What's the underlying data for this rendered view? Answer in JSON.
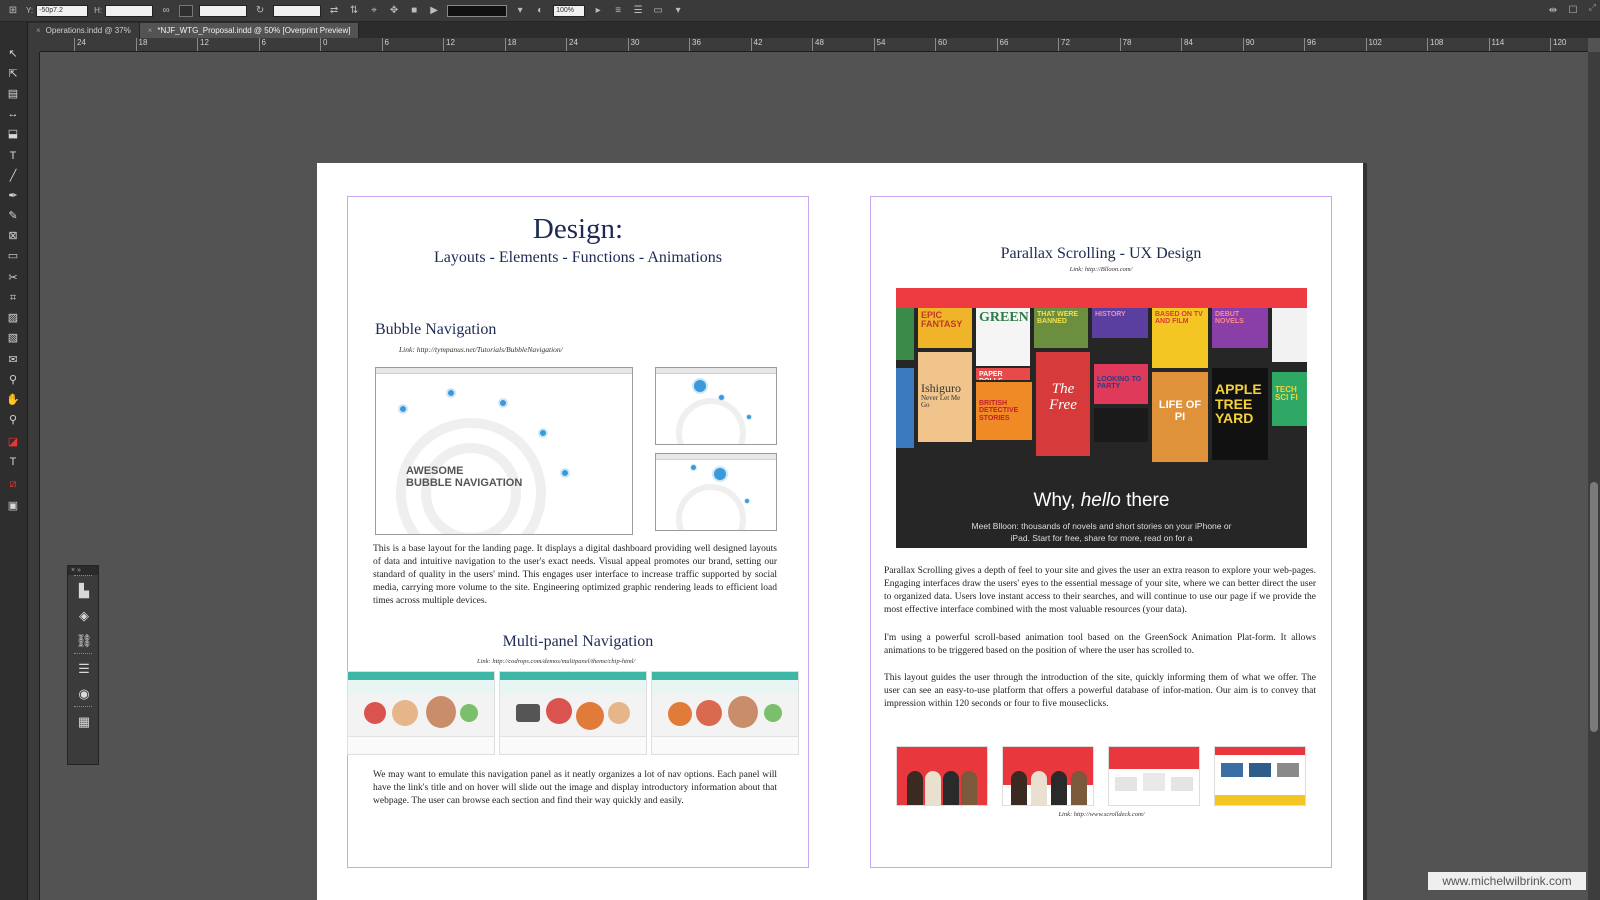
{
  "control_bar": {
    "y_label": "Y:",
    "y_value": "-50p7.2",
    "h_label": "H:",
    "zoom_value": "100%"
  },
  "tabs": [
    {
      "label": "Operations.indd @ 37%"
    },
    {
      "label": "*NJF_WTG_Proposal.indd @ 50% [Overprint Preview]"
    }
  ],
  "ruler_ticks": [
    "24",
    "18",
    "12",
    "6",
    "0",
    "6",
    "12",
    "18",
    "24",
    "30",
    "36",
    "42",
    "48",
    "54",
    "60",
    "66",
    "72",
    "78",
    "84",
    "90",
    "96",
    "102",
    "108",
    "114",
    "120"
  ],
  "left_page": {
    "title": "Design:",
    "subtitle": "Layouts - Elements - Functions - Animations",
    "bubble": {
      "heading": "Bubble Navigation",
      "link": "Link:  http://tympanus.net/Tutorials/BubbleNavigation/",
      "mock_title_line1": "AWESOME",
      "mock_title_line2": "BUBBLE NAVIGATION",
      "body": "This is a base layout for the landing page. It displays a digital dashboard providing well designed layouts of data and intuitive navigation to the user's exact needs. Visual appeal promotes our brand, setting our standard of quality in the users' mind. This engages user interface to increase traffic supported by social media, carrying more volume to the site.  Engineering optimized graphic rendering leads to efficient load times across multiple devices."
    },
    "multipanel": {
      "heading": "Multi-panel Navigation",
      "link": "Link: http://codrops.com/demos/multipanel/theme/chip-html/",
      "body": "We may want to emulate this navigation panel as it neatly organizes a lot of nav options. Each panel will have the link's title and on hover will slide out the image and display introductory information about that webpage. The user can browse each section and find their way quickly and easily."
    }
  },
  "right_page": {
    "title": "Parallax Scrolling - UX Design",
    "link": "Link: http://Blloon.com/",
    "hero": {
      "title_pre": "Why, ",
      "title_em": "hello",
      "title_post": " there",
      "sub": "Meet Blloon: thousands of novels and short stories on your iPhone or iPad. Start for free, share for more, read on for a"
    },
    "books": {
      "b1": "EPIC FANTASY",
      "b2": "GREEN",
      "b3": "THAT WERE BANNED",
      "b4": "HISTORY",
      "b5": "BASED ON TV AND FILM",
      "b6": "DEBUT NOVELS",
      "b7": "PAPER DOLLS",
      "b8": "Ishiguro",
      "b8b": "Never Let Me Go",
      "b9": "BRITISH DETECTIVE STORIES",
      "b10": "The Free",
      "b11": "LOOKING TO PARTY",
      "b12": "LIFE OF PI",
      "b13": "APPLE TREE YARD",
      "b14": "TECH SCI FI"
    },
    "para1": "Parallax Scrolling gives a depth of feel to your site and gives the user an extra reason to explore your web-pages. Engaging interfaces draw the users' eyes to the essential message of your site, where we can better direct the user to organized data. Users love instant access to their searches, and will continue to use our page if we provide the most effective interface combined with the most valuable resources (your data).",
    "para2": "I'm using a powerful scroll-based animation tool based on the GreenSock Animation Plat-form. It allows animations to be triggered based on the position of where the user has scrolled to.",
    "para3": "This layout guides the user through the introduction of the site, quickly informing them of what we offer. The user can see an easy-to-use platform that offers a powerful database of infor-mation. Our aim is to convey that impression within 120 seconds or four to five mouseclicks.",
    "thumbs_link": "Link: http://www.scrolldeck.com/"
  },
  "watermark": "www.michelwilbrink.com",
  "colors": {
    "heading_navy": "#1d2a54",
    "margin_guide": "#c9a7f0",
    "hero_red": "#ee3a41",
    "pasteboard": "#535353"
  }
}
